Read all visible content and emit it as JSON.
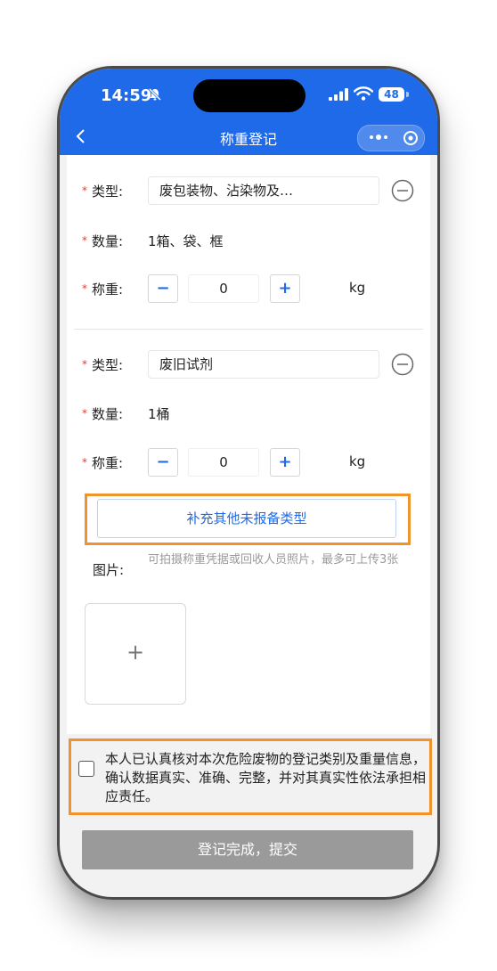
{
  "status_bar": {
    "time": "14:59",
    "battery": "48"
  },
  "nav": {
    "title": "称重登记"
  },
  "items": [
    {
      "type_label": "类型:",
      "type_value": "废包装物、沾染物及…",
      "qty_label": "数量:",
      "qty_value": "1箱、袋、框",
      "weight_label": "称重:",
      "weight_value": "0",
      "unit": "kg"
    },
    {
      "type_label": "类型:",
      "type_value": "废旧试剂",
      "qty_label": "数量:",
      "qty_value": "1桶",
      "weight_label": "称重:",
      "weight_value": "0",
      "unit": "kg"
    }
  ],
  "stepper": {
    "minus": "−",
    "plus": "+"
  },
  "add_type_button": "补充其他未报备类型",
  "photo": {
    "label": "图片:",
    "hint": "可拍摄称重凭据或回收人员照片，最多可上传3张",
    "add": "+"
  },
  "consent_text": "本人已认真核对本次危险废物的登记类别及重量信息，确认数据真实、准确、完整，并对其真实性依法承担相应责任。",
  "submit_button": "登记完成，提交",
  "colors": {
    "brand": "#1f6ae8",
    "required": "#e23a2e",
    "highlight": "#f0932b",
    "disabled": "#9a9a9a"
  }
}
